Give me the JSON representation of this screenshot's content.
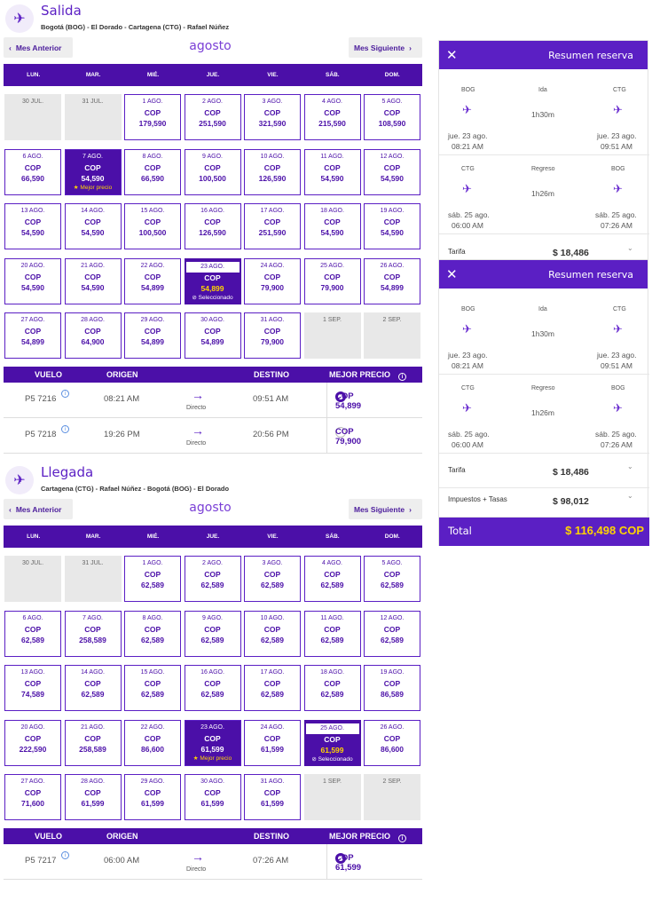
{
  "salida": {
    "title": "Salida",
    "route": "Bogotá (BOG) - El Dorado - Cartagena (CTG) - Rafael Núñez",
    "prev": "Mes Anterior",
    "next": "Mes Siguiente",
    "month": "agosto",
    "days": [
      "LUN.",
      "MAR.",
      "MIÉ.",
      "JUE.",
      "VIE.",
      "SÁB.",
      "DOM."
    ],
    "cells": [
      {
        "d": "30 JUL.",
        "c": "",
        "p": "",
        "s": "off"
      },
      {
        "d": "31 JUL.",
        "c": "",
        "p": "",
        "s": "off"
      },
      {
        "d": "1 AGO.",
        "c": "COP",
        "p": "179,590",
        "s": ""
      },
      {
        "d": "2 AGO.",
        "c": "COP",
        "p": "251,590",
        "s": ""
      },
      {
        "d": "3 AGO.",
        "c": "COP",
        "p": "321,590",
        "s": ""
      },
      {
        "d": "4 AGO.",
        "c": "COP",
        "p": "215,590",
        "s": ""
      },
      {
        "d": "5 AGO.",
        "c": "COP",
        "p": "108,590",
        "s": ""
      },
      {
        "d": "6 AGO.",
        "c": "COP",
        "p": "66,590",
        "s": ""
      },
      {
        "d": "7 AGO.",
        "c": "COP",
        "p": "54,590",
        "s": "best",
        "tag": "★ Mejor precio"
      },
      {
        "d": "8 AGO.",
        "c": "COP",
        "p": "66,590",
        "s": ""
      },
      {
        "d": "9 AGO.",
        "c": "COP",
        "p": "100,500",
        "s": ""
      },
      {
        "d": "10 AGO.",
        "c": "COP",
        "p": "126,590",
        "s": ""
      },
      {
        "d": "11 AGO.",
        "c": "COP",
        "p": "54,590",
        "s": ""
      },
      {
        "d": "12 AGO.",
        "c": "COP",
        "p": "54,590",
        "s": ""
      },
      {
        "d": "13 AGO.",
        "c": "COP",
        "p": "54,590",
        "s": ""
      },
      {
        "d": "14 AGO.",
        "c": "COP",
        "p": "54,590",
        "s": ""
      },
      {
        "d": "15 AGO.",
        "c": "COP",
        "p": "100,500",
        "s": ""
      },
      {
        "d": "16 AGO.",
        "c": "COP",
        "p": "126,590",
        "s": ""
      },
      {
        "d": "17 AGO.",
        "c": "COP",
        "p": "251,590",
        "s": ""
      },
      {
        "d": "18 AGO.",
        "c": "COP",
        "p": "54,590",
        "s": ""
      },
      {
        "d": "19 AGO.",
        "c": "COP",
        "p": "54,590",
        "s": ""
      },
      {
        "d": "20 AGO.",
        "c": "COP",
        "p": "54,590",
        "s": ""
      },
      {
        "d": "21 AGO.",
        "c": "COP",
        "p": "54,590",
        "s": ""
      },
      {
        "d": "22 AGO.",
        "c": "COP",
        "p": "54,899",
        "s": ""
      },
      {
        "d": "23 AGO.",
        "c": "COP",
        "p": "54,899",
        "s": "sel",
        "tag": "⊘ Seleccionado"
      },
      {
        "d": "24 AGO.",
        "c": "COP",
        "p": "79,900",
        "s": ""
      },
      {
        "d": "25 AGO.",
        "c": "COP",
        "p": "79,900",
        "s": ""
      },
      {
        "d": "26 AGO.",
        "c": "COP",
        "p": "54,899",
        "s": ""
      },
      {
        "d": "27 AGO.",
        "c": "COP",
        "p": "54,899",
        "s": ""
      },
      {
        "d": "28 AGO.",
        "c": "COP",
        "p": "64,900",
        "s": ""
      },
      {
        "d": "29 AGO.",
        "c": "COP",
        "p": "54,899",
        "s": ""
      },
      {
        "d": "30 AGO.",
        "c": "COP",
        "p": "54,899",
        "s": ""
      },
      {
        "d": "31 AGO.",
        "c": "COP",
        "p": "79,900",
        "s": ""
      },
      {
        "d": "1 SEP.",
        "c": "",
        "p": "",
        "s": "off"
      },
      {
        "d": "2 SEP.",
        "c": "",
        "p": "",
        "s": "off"
      }
    ],
    "flights_header": {
      "vuelo": "VUELO",
      "origen": "ORIGEN",
      "destino": "DESTINO",
      "mejor": "MEJOR PRECIO"
    },
    "flights": [
      {
        "num": "P5 7216",
        "dep": "08:21 AM",
        "type": "Directo",
        "arr": "09:51 AM",
        "price": "COP 54,899",
        "selected": true
      },
      {
        "num": "P5 7218",
        "dep": "19:26 PM",
        "type": "Directo",
        "arr": "20:56 PM",
        "price": "COP 79,900",
        "selected": false
      }
    ]
  },
  "llegada": {
    "title": "Llegada",
    "route": "Cartagena (CTG) - Rafael Núñez - Bogotá (BOG) - El Dorado",
    "prev": "Mes Anterior",
    "next": "Mes Siguiente",
    "month": "agosto",
    "days": [
      "LUN.",
      "MAR.",
      "MIÉ.",
      "JUE.",
      "VIE.",
      "SÁB.",
      "DOM."
    ],
    "cells": [
      {
        "d": "30 JUL.",
        "c": "",
        "p": "",
        "s": "off"
      },
      {
        "d": "31 JUL.",
        "c": "",
        "p": "",
        "s": "off"
      },
      {
        "d": "1 AGO.",
        "c": "COP",
        "p": "62,589",
        "s": ""
      },
      {
        "d": "2 AGO.",
        "c": "COP",
        "p": "62,589",
        "s": ""
      },
      {
        "d": "3 AGO.",
        "c": "COP",
        "p": "62,589",
        "s": ""
      },
      {
        "d": "4 AGO.",
        "c": "COP",
        "p": "62,589",
        "s": ""
      },
      {
        "d": "5 AGO.",
        "c": "COP",
        "p": "62,589",
        "s": ""
      },
      {
        "d": "6 AGO.",
        "c": "COP",
        "p": "62,589",
        "s": ""
      },
      {
        "d": "7 AGO.",
        "c": "COP",
        "p": "258,589",
        "s": ""
      },
      {
        "d": "8 AGO.",
        "c": "COP",
        "p": "62,589",
        "s": ""
      },
      {
        "d": "9 AGO.",
        "c": "COP",
        "p": "62,589",
        "s": ""
      },
      {
        "d": "10 AGO.",
        "c": "COP",
        "p": "62,589",
        "s": ""
      },
      {
        "d": "11 AGO.",
        "c": "COP",
        "p": "62,589",
        "s": ""
      },
      {
        "d": "12 AGO.",
        "c": "COP",
        "p": "62,589",
        "s": ""
      },
      {
        "d": "13 AGO.",
        "c": "COP",
        "p": "74,589",
        "s": ""
      },
      {
        "d": "14 AGO.",
        "c": "COP",
        "p": "62,589",
        "s": ""
      },
      {
        "d": "15 AGO.",
        "c": "COP",
        "p": "62,589",
        "s": ""
      },
      {
        "d": "16 AGO.",
        "c": "COP",
        "p": "62,589",
        "s": ""
      },
      {
        "d": "17 AGO.",
        "c": "COP",
        "p": "62,589",
        "s": ""
      },
      {
        "d": "18 AGO.",
        "c": "COP",
        "p": "62,589",
        "s": ""
      },
      {
        "d": "19 AGO.",
        "c": "COP",
        "p": "86,589",
        "s": ""
      },
      {
        "d": "20 AGO.",
        "c": "COP",
        "p": "222,590",
        "s": ""
      },
      {
        "d": "21 AGO.",
        "c": "COP",
        "p": "258,589",
        "s": ""
      },
      {
        "d": "22 AGO.",
        "c": "COP",
        "p": "86,600",
        "s": ""
      },
      {
        "d": "23 AGO.",
        "c": "COP",
        "p": "61,599",
        "s": "best",
        "tag": "★ Mejor precio"
      },
      {
        "d": "24 AGO.",
        "c": "COP",
        "p": "61,599",
        "s": ""
      },
      {
        "d": "25 AGO.",
        "c": "COP",
        "p": "61,599",
        "s": "sel",
        "tag": "⊘ Seleccionado"
      },
      {
        "d": "26 AGO.",
        "c": "COP",
        "p": "86,600",
        "s": ""
      },
      {
        "d": "27 AGO.",
        "c": "COP",
        "p": "71,600",
        "s": ""
      },
      {
        "d": "28 AGO.",
        "c": "COP",
        "p": "61,599",
        "s": ""
      },
      {
        "d": "29 AGO.",
        "c": "COP",
        "p": "61,599",
        "s": ""
      },
      {
        "d": "30 AGO.",
        "c": "COP",
        "p": "61,599",
        "s": ""
      },
      {
        "d": "31 AGO.",
        "c": "COP",
        "p": "61,599",
        "s": ""
      },
      {
        "d": "1 SEP.",
        "c": "",
        "p": "",
        "s": "off"
      },
      {
        "d": "2 SEP.",
        "c": "",
        "p": "",
        "s": "off"
      }
    ],
    "flights_header": {
      "vuelo": "VUELO",
      "origen": "ORIGEN",
      "destino": "DESTINO",
      "mejor": "MEJOR PRECIO"
    },
    "flights": [
      {
        "num": "P5 7217",
        "dep": "06:00 AM",
        "type": "Directo",
        "arr": "07:26 AM",
        "price": "COP 61,599",
        "selected": true
      }
    ]
  },
  "summary": {
    "title": "Resumen reserva",
    "close": "✕",
    "ida": {
      "from": "BOG",
      "label": "Ida",
      "to": "CTG",
      "duration": "1h30m",
      "dep_date": "jue. 23 ago.",
      "dep_time": "08:21 AM",
      "arr_date": "jue. 23 ago.",
      "arr_time": "09:51 AM"
    },
    "regreso": {
      "from": "CTG",
      "label": "Regreso",
      "to": "BOG",
      "duration": "1h26m",
      "dep_date": "sáb. 25 ago.",
      "dep_time": "06:00 AM",
      "arr_date": "sáb. 25 ago.",
      "arr_time": "07:26 AM"
    },
    "tarifa_label": "Tarifa",
    "tarifa_value": "$ 18,486",
    "impuestos_label": "Impuestos + Tasas",
    "impuestos_value": "$ 98,012",
    "total_label": "Total",
    "total_value": "$ 116,498 COP"
  },
  "colors": {
    "primary": "#4b0fa8",
    "accent": "#ffd400",
    "panel": "#5b1fc4"
  }
}
